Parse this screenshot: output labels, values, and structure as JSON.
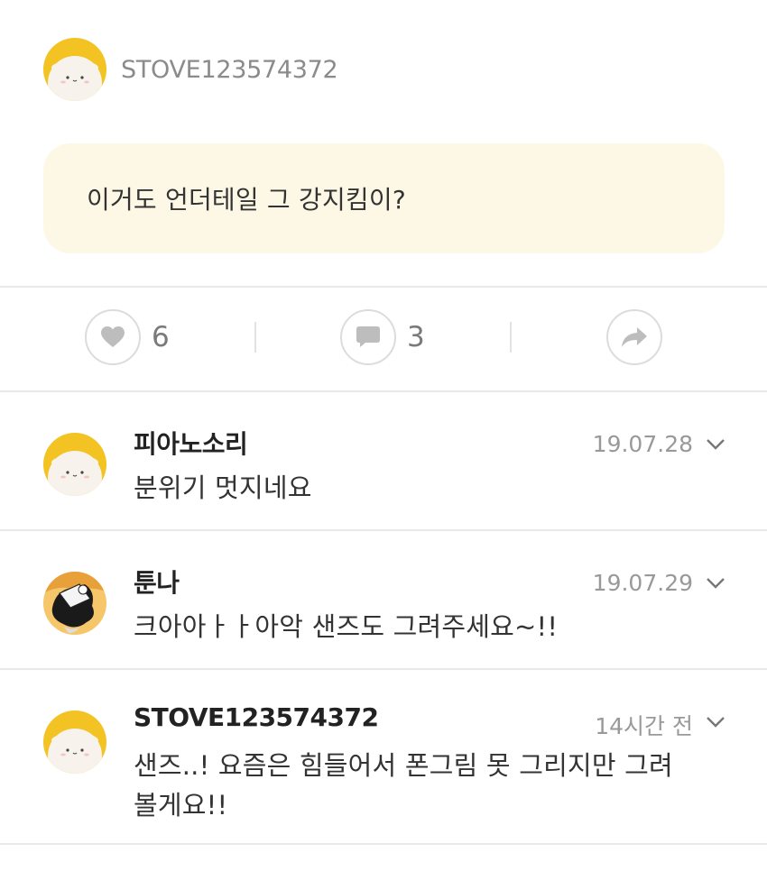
{
  "post": {
    "author": "STOVE123574372",
    "text": "이거도 언더테일 그 강지킴이?"
  },
  "actions": {
    "like_count": "6",
    "comment_count": "3"
  },
  "comments": [
    {
      "name": "피아노소리",
      "date": "19.07.28",
      "text": "분위기 멋지네요"
    },
    {
      "name": "툰나",
      "date": "19.07.29",
      "text": "크아아ㅏㅏ아악 샌즈도 그려주세요~!!"
    },
    {
      "name": "STOVE123574372",
      "date": "14시간 전",
      "text_line1": "샌즈..! 요즘은 힘들어서 폰그림 못 그리지만 그려",
      "text_line2": "볼게요!!"
    }
  ],
  "colors": {
    "accent_yellow": "#f2c322",
    "bubble_bg": "#fdf8e6",
    "divider": "#e9e9e9"
  },
  "icons": [
    "heart-icon",
    "speech-bubble-icon",
    "share-arrow-icon",
    "chevron-down-icon"
  ]
}
